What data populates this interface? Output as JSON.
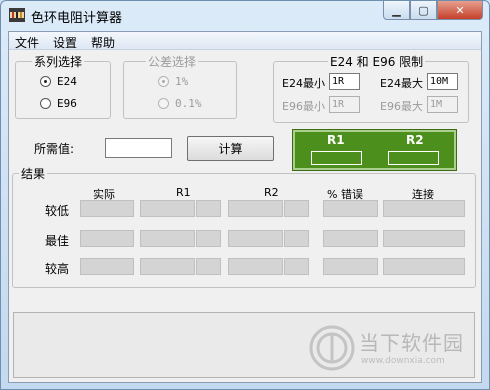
{
  "window": {
    "title": "色环电阻计算器"
  },
  "window_buttons": {
    "minimize": "▁",
    "maximize": "▢",
    "close": "✕"
  },
  "menu": [
    "文件",
    "设置",
    "帮助"
  ],
  "series_group": {
    "title": "系列选择",
    "options": [
      {
        "label": "E24",
        "selected": true
      },
      {
        "label": "E96",
        "selected": false
      }
    ]
  },
  "tolerance_group": {
    "title": "公差选择",
    "options": [
      {
        "label": "1%",
        "selected": true
      },
      {
        "label": "0.1%",
        "selected": false
      }
    ]
  },
  "limits_group": {
    "title": "E24 和 E96 限制",
    "e24_min_label": "E24最小",
    "e24_min_value": "1R",
    "e24_max_label": "E24最大",
    "e24_max_value": "10M",
    "e96_min_label": "E96最小",
    "e96_min_value": "1R",
    "e96_max_label": "E96最大",
    "e96_max_value": "1M"
  },
  "required": {
    "label": "所需值:",
    "value": ""
  },
  "calc_button": "计算",
  "resistor_panel": {
    "r1": "R1",
    "r2": "R2"
  },
  "results": {
    "title": "结果",
    "headers": [
      "实际",
      "R1",
      "R2",
      "% 错误",
      "连接"
    ],
    "rows": [
      "较低",
      "最佳",
      "较高"
    ]
  },
  "watermark": {
    "name": "当下软件园",
    "url": "www.downxia.com"
  },
  "colors": {
    "panel_green": "#4d8f1c",
    "title_bg": "#dcebf8"
  }
}
